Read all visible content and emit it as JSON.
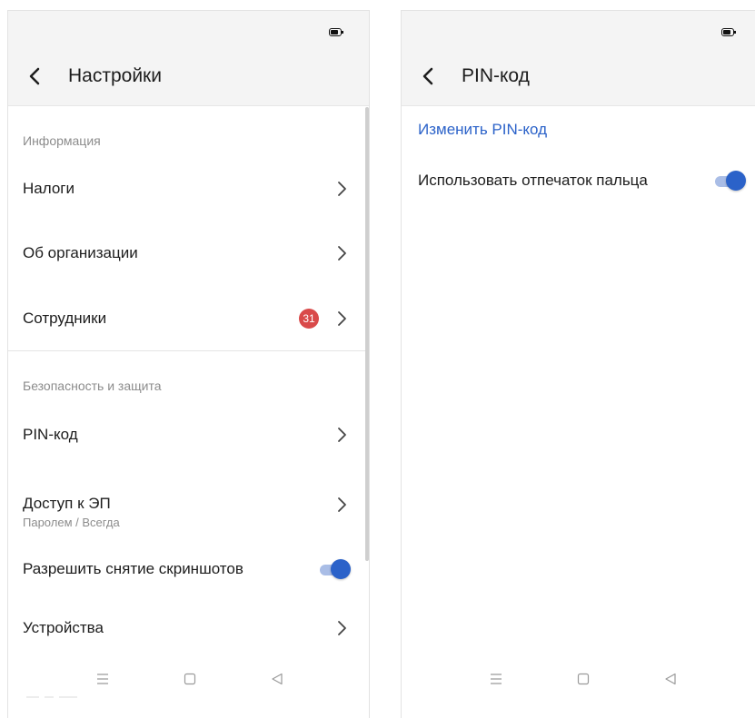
{
  "left_screen": {
    "title": "Настройки",
    "icons": {
      "back": "chevron-left-icon",
      "battery": "battery-icon",
      "chevron": "chevron-right-icon"
    },
    "sections": [
      {
        "header": "Информация",
        "items": [
          {
            "label": "Налоги"
          },
          {
            "label": "Об организации"
          },
          {
            "label": "Сотрудники",
            "badge": "31"
          }
        ]
      },
      {
        "header": "Безопасность и защита",
        "items": [
          {
            "label": "PIN-код"
          },
          {
            "label": "Доступ к ЭП",
            "sublabel": "Паролем / Всегда"
          },
          {
            "label": "Разрешить снятие скриншотов",
            "toggle": true
          },
          {
            "label": "Устройства"
          }
        ]
      }
    ]
  },
  "right_screen": {
    "title": "PIN-код",
    "change_pin_link": "Изменить PIN-код",
    "fingerprint_label": "Использовать отпечаток пальца",
    "fingerprint_enabled": true
  },
  "navbar": {
    "icons": [
      "menu-icon",
      "home-icon",
      "back-triangle-icon"
    ]
  },
  "colors": {
    "accent": "#2b62c9",
    "toggle_track": "#a9bde6",
    "badge": "#d94a4a",
    "appbar_bg": "#f4f4f4",
    "secondary_text": "#8c8c8c",
    "primary_text": "#1d1d1d"
  }
}
